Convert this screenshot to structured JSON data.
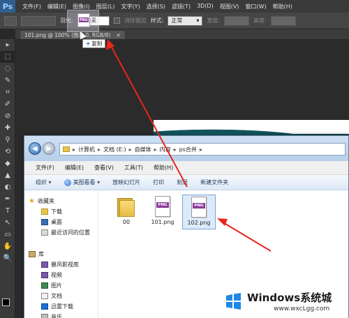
{
  "photoshop": {
    "logo": "Ps",
    "menu": [
      "文件(F)",
      "编辑(E)",
      "图像(I)",
      "图层(L)",
      "文字(Y)",
      "选择(S)",
      "滤镜(T)",
      "3D(D)",
      "视图(V)",
      "窗口(W)",
      "帮助(H)"
    ],
    "options": {
      "feather_label": "羽化:",
      "feather_value": "0 像素",
      "antialias_label": "消除锯齿",
      "style_label": "样式:",
      "style_value": "正常",
      "width_label": "宽度:",
      "height_label": "高度:"
    },
    "doc_tab": "101.png @ 100% (图层 0, RGB/8)",
    "doc_tab_close": "×",
    "tools": [
      "▸",
      "⬚",
      "◌",
      "✎",
      "⌗",
      "✐",
      "⊘",
      "✚",
      "⚲",
      "⟲",
      "◆",
      "▲",
      "◐",
      "✒",
      "T",
      "↖",
      "▭",
      "✋",
      "🔍"
    ],
    "drag_ghost_text": "PNG",
    "copy_tooltip": "复制",
    "copy_tooltip_plus": "+"
  },
  "explorer": {
    "breadcrumb": [
      "计算机",
      "文档 (E:)",
      "自媒体",
      "内容",
      "ps合并"
    ],
    "breadcrumb_sep": "▸",
    "menu": [
      "文件(F)",
      "编辑(E)",
      "查看(V)",
      "工具(T)",
      "帮助(H)"
    ],
    "commands": {
      "organize": "组织",
      "gallery": "美图看看",
      "slideshow": "放映幻灯片",
      "print": "打印",
      "burn": "刻录",
      "new_folder": "新建文件夹"
    },
    "nav": {
      "favorites": "收藏夹",
      "favorites_items": [
        "下载",
        "桌面",
        "最近访问的位置"
      ],
      "libraries": "库",
      "libraries_items": [
        "暴风影视库",
        "视频",
        "图片",
        "文档",
        "迅雷下载",
        "音乐"
      ]
    },
    "files": [
      {
        "name": "00",
        "type": "folder"
      },
      {
        "name": "101.png",
        "type": "png",
        "badge": "PNG"
      },
      {
        "name": "102.png",
        "type": "png",
        "badge": "PNG",
        "selected": true
      }
    ]
  },
  "colors": {
    "arrow": "#e8261c",
    "png_badge": "#8a3c9b"
  },
  "watermark": {
    "title": "Windows系统城",
    "url": "www.wxcLgg.com"
  }
}
